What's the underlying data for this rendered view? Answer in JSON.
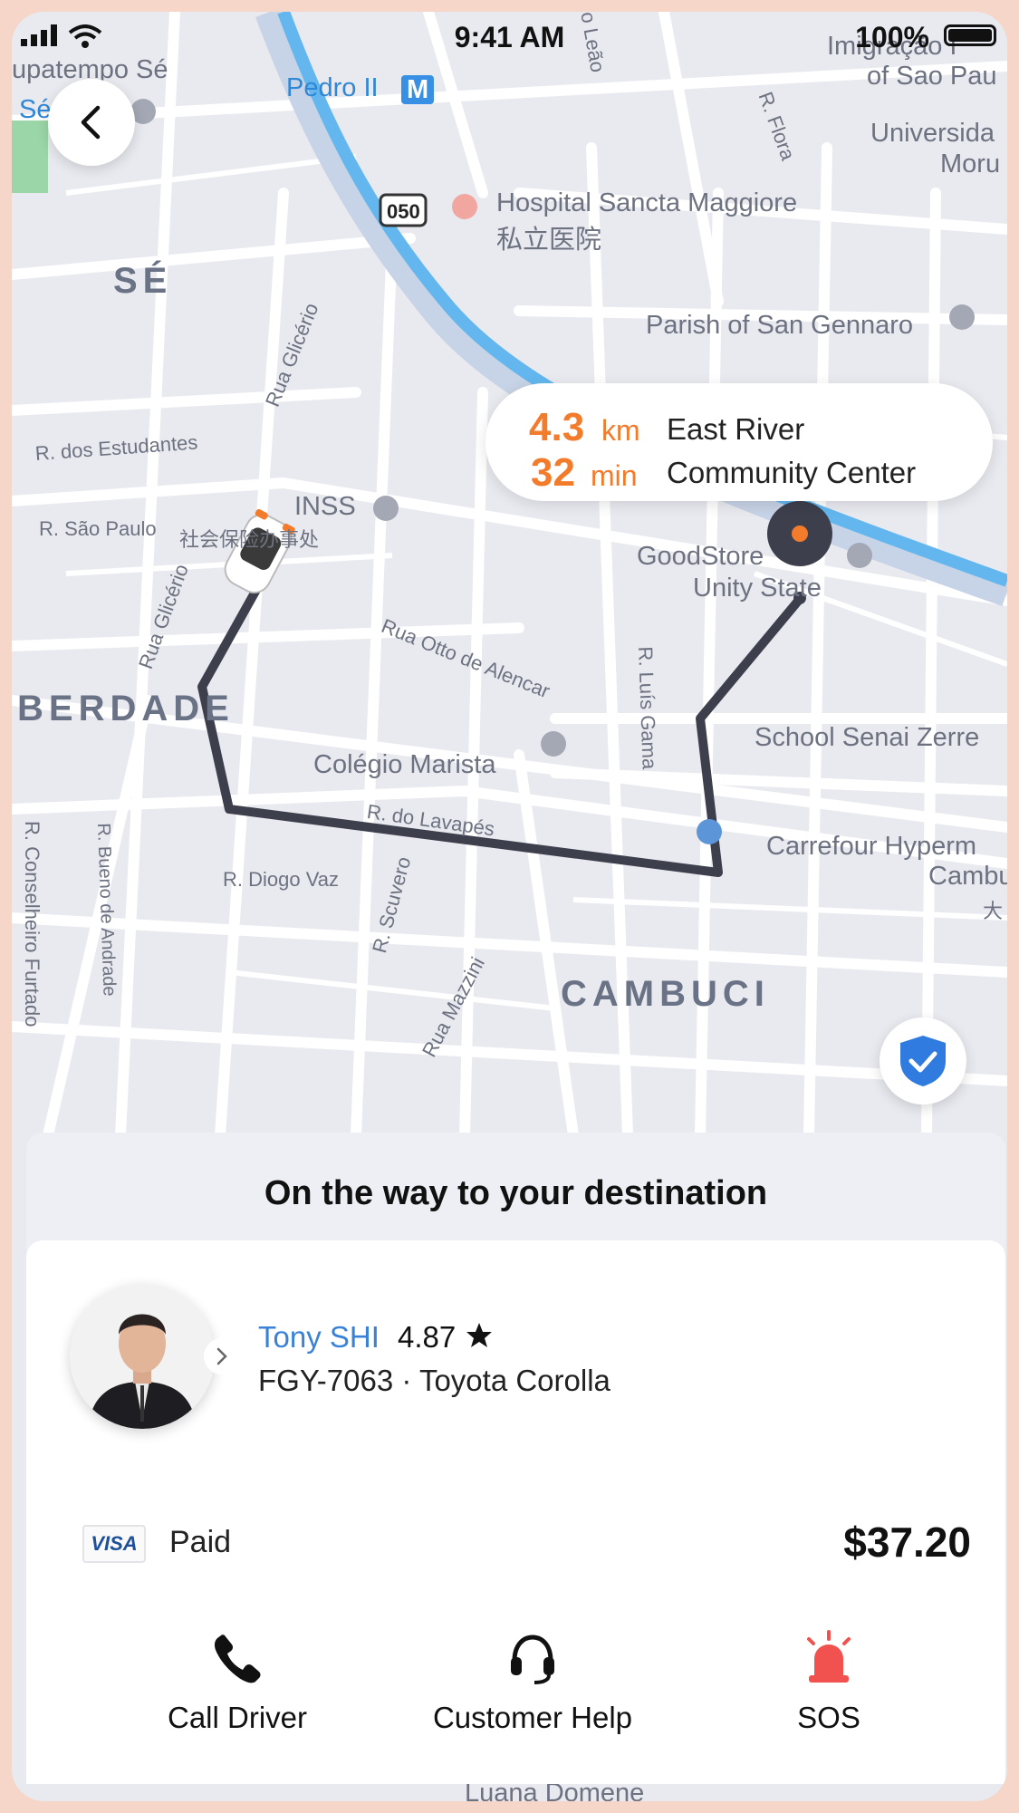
{
  "status_bar": {
    "time": "9:41 AM",
    "battery": "100%"
  },
  "map": {
    "labels": {
      "patempo_se": "upatempo Sé",
      "se_small": "Sé",
      "pedro_ii": "Pedro II",
      "metro_badge": "M",
      "road_050": "050",
      "hospital": "Hospital Sancta Maggiore",
      "hospital_cn": "私立医院",
      "parish": "Parish of San Gennaro",
      "district_se": "SÉ",
      "rua_glicerio_1": "Rua Glicério",
      "dos_estudantes": "R. dos Estudantes",
      "sao_paulo": "R. São Paulo",
      "inss": "INSS",
      "inss_cn": "社会保险办事处",
      "rua_glicerio_2": "Rua Glicério",
      "otto": "Rua Otto de Alencar",
      "luis_gama": "R. Luís Gama",
      "goodstore_1": "GoodStore",
      "goodstore_2": "Unity State",
      "liberdade": "BERDADE",
      "marista": "Colégio Marista",
      "school": "School Senai Zerre",
      "lavapes": "R. do Lavapés",
      "carrefour_1": "Carrefour Hyperm",
      "carrefour_2": "Cambu",
      "carrefour_3": "大",
      "conselheiro": "R. Conselheiro Furtado",
      "bueno": "R. Bueno de Andrade",
      "diogo": "R. Diogo Vaz",
      "scuvero": "R. Scuvero",
      "mazzini": "Rua Mazzini",
      "cambuci": "CAMBUCI",
      "leao": "o Leão",
      "flora": "R. Flora",
      "imigracao_1": "Imigração I",
      "imigracao_2": "of Sao Pau",
      "universidade_1": "Universida",
      "universidade_2": "Moru",
      "bottom_street": "Luana Domene"
    }
  },
  "eta": {
    "distance_value": "4.3",
    "distance_unit": "km",
    "time_value": "32",
    "time_unit": "min",
    "destination_line1": "East River",
    "destination_line2": "Community Center"
  },
  "trip": {
    "status_title": "On the way to your destination",
    "driver_name": "Tony SHI",
    "driver_rating": "4.87",
    "plate_and_car": "FGY-7063 · Toyota Corolla",
    "payment_brand": "VISA",
    "payment_status": "Paid",
    "amount": "$37.20"
  },
  "actions": {
    "call_driver": "Call Driver",
    "customer_help": "Customer Help",
    "sos": "SOS"
  },
  "icons": {
    "back": "chevron-left-icon",
    "shield": "shield-check-icon",
    "phone": "phone-icon",
    "headset": "headset-icon",
    "siren": "siren-icon",
    "star": "star-icon"
  },
  "colors": {
    "accent_orange": "#f37b2c",
    "driver_blue": "#3a82d8",
    "sos_red": "#f2524f",
    "route": "#3d3f4d",
    "shield_blue": "#2f7be0"
  }
}
